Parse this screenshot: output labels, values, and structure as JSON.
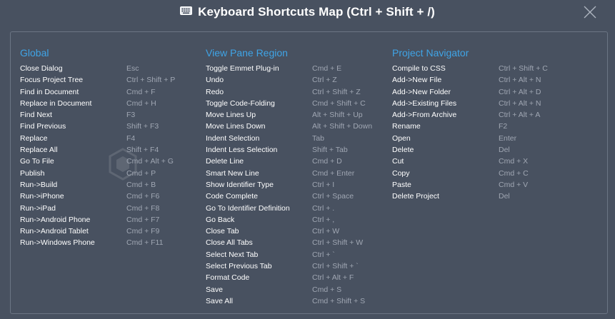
{
  "header": {
    "title": "Keyboard Shortcuts Map (Ctrl + Shift + /)"
  },
  "columns": [
    {
      "heading": "Global",
      "rows": [
        {
          "action": "Close Dialog",
          "keys": "Esc"
        },
        {
          "action": "Focus Project Tree",
          "keys": "Ctrl + Shift + P"
        },
        {
          "action": "Find in Document",
          "keys": "Cmd + F"
        },
        {
          "action": "Replace in Document",
          "keys": "Cmd + H"
        },
        {
          "action": "Find Next",
          "keys": "F3"
        },
        {
          "action": "Find Previous",
          "keys": "Shift + F3"
        },
        {
          "action": "Replace",
          "keys": "F4"
        },
        {
          "action": "Replace All",
          "keys": "Shift + F4"
        },
        {
          "action": "Go To File",
          "keys": "Cmd + Alt + G"
        },
        {
          "action": "Publish",
          "keys": "Cmd + P"
        },
        {
          "action": "Run->Build",
          "keys": "Cmd + B"
        },
        {
          "action": "Run->iPhone",
          "keys": "Cmd + F6"
        },
        {
          "action": "Run->iPad",
          "keys": "Cmd + F8"
        },
        {
          "action": "Run->Android Phone",
          "keys": "Cmd + F7"
        },
        {
          "action": "Run->Android Tablet",
          "keys": "Cmd + F9"
        },
        {
          "action": "Run->Windows Phone",
          "keys": "Cmd + F11"
        }
      ]
    },
    {
      "heading": "View Pane Region",
      "rows": [
        {
          "action": "Toggle Emmet Plug-in",
          "keys": "Cmd + E"
        },
        {
          "action": "Undo",
          "keys": "Ctrl + Z"
        },
        {
          "action": "Redo",
          "keys": "Ctrl + Shift + Z"
        },
        {
          "action": "Toggle Code-Folding",
          "keys": "Cmd + Shift + C"
        },
        {
          "action": "Move Lines Up",
          "keys": "Alt + Shift + Up"
        },
        {
          "action": "Move Lines Down",
          "keys": "Alt + Shift + Down"
        },
        {
          "action": "Indent Selection",
          "keys": "Tab"
        },
        {
          "action": "Indent Less Selection",
          "keys": "Shift + Tab"
        },
        {
          "action": "Delete Line",
          "keys": "Cmd + D"
        },
        {
          "action": "Smart New Line",
          "keys": "Cmd + Enter"
        },
        {
          "action": "Show Identifier Type",
          "keys": "Ctrl + I"
        },
        {
          "action": "Code Complete",
          "keys": "Ctrl + Space"
        },
        {
          "action": "Go To Identifier Definition",
          "keys": "Ctrl + ."
        },
        {
          "action": "Go Back",
          "keys": "Ctrl + ,"
        },
        {
          "action": "Close Tab",
          "keys": "Ctrl + W"
        },
        {
          "action": "Close All Tabs",
          "keys": "Ctrl + Shift + W"
        },
        {
          "action": "Select Next Tab",
          "keys": "Ctrl + `"
        },
        {
          "action": "Select Previous Tab",
          "keys": "Ctrl + Shift + `"
        },
        {
          "action": "Format Code",
          "keys": "Ctrl + Alt + F"
        },
        {
          "action": "Save",
          "keys": "Cmd + S"
        },
        {
          "action": "Save All",
          "keys": "Cmd + Shift + S"
        }
      ]
    },
    {
      "heading": "Project Navigator",
      "rows": [
        {
          "action": "Compile to CSS",
          "keys": "Ctrl + Shift + C"
        },
        {
          "action": "Add->New File",
          "keys": "Ctrl + Alt + N"
        },
        {
          "action": "Add->New Folder",
          "keys": "Ctrl + Alt + D"
        },
        {
          "action": "Add->Existing Files",
          "keys": "Ctrl + Alt + N"
        },
        {
          "action": "Add->From Archive",
          "keys": "Ctrl + Alt + A"
        },
        {
          "action": "Rename",
          "keys": "F2"
        },
        {
          "action": "Open",
          "keys": "Enter"
        },
        {
          "action": "Delete",
          "keys": "Del"
        },
        {
          "action": "Cut",
          "keys": "Cmd + X"
        },
        {
          "action": "Copy",
          "keys": "Cmd + C"
        },
        {
          "action": "Paste",
          "keys": "Cmd + V"
        },
        {
          "action": "Delete Project",
          "keys": "Del"
        }
      ]
    }
  ]
}
